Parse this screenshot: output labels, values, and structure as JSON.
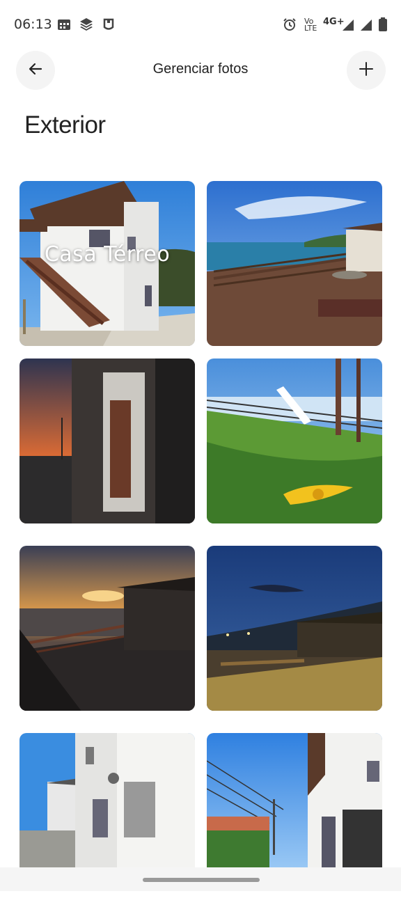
{
  "status_bar": {
    "time": "06:13",
    "network_label_top": "Vo",
    "network_label_bottom": "LTE",
    "network_type": "4G+",
    "icons": [
      "calendar-icon",
      "layers-icon",
      "app-icon",
      "alarm-icon",
      "signal-icon",
      "signal-icon",
      "battery-icon"
    ]
  },
  "header": {
    "title": "Gerenciar fotos",
    "back_icon": "arrow-left-icon",
    "add_icon": "plus-icon"
  },
  "section": {
    "title": "Exterior"
  },
  "photos": [
    {
      "label": "Casa Térreo",
      "description": "white house with exterior stairs"
    },
    {
      "description": "wooden deck overlooking beach"
    },
    {
      "description": "dusk street beside building"
    },
    {
      "description": "lawn with yellow flower and railing"
    },
    {
      "description": "sunset over sea from deck"
    },
    {
      "description": "night view of deck and beach"
    },
    {
      "description": "white building with street"
    },
    {
      "description": "street with power lines and buildings"
    }
  ]
}
